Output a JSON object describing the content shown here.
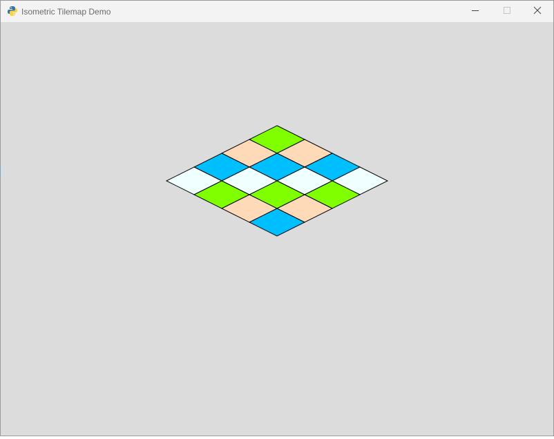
{
  "window": {
    "title": "Isometric Tilemap Demo",
    "icons": {
      "app": "python-snake-icon",
      "minimize": "minimize-icon",
      "maximize": "maximize-icon",
      "close": "close-icon"
    }
  },
  "tilemap": {
    "rows": 4,
    "cols": 4,
    "tiles": [
      [
        "grass",
        "sand",
        "water",
        "ice"
      ],
      [
        "sand",
        "water",
        "ice",
        "grass"
      ],
      [
        "water",
        "ice",
        "grass",
        "sand"
      ],
      [
        "ice",
        "grass",
        "sand",
        "water"
      ]
    ],
    "colors": {
      "grass": "#7fff00",
      "sand": "#ffdab9",
      "water": "#00bfff",
      "ice": "#f0ffff",
      "outline": "#000000",
      "background": "#dcdcdc"
    }
  }
}
